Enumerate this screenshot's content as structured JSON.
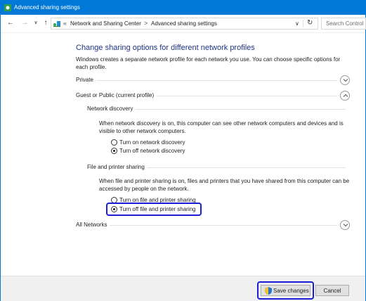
{
  "window": {
    "title": "Advanced sharing settings"
  },
  "address_bar": {
    "overflow_glyph": "«",
    "breadcrumbs": [
      "Network and Sharing Center",
      "Advanced sharing settings"
    ],
    "separator": ">",
    "search_placeholder": "Search Control"
  },
  "content": {
    "heading": "Change sharing options for different network profiles",
    "intro": "Windows creates a separate network profile for each network you use. You can choose specific options for each profile."
  },
  "profiles": {
    "private": {
      "label": "Private",
      "expanded": false
    },
    "guest_public": {
      "label": "Guest or Public (current profile)",
      "expanded": true
    },
    "all_networks": {
      "label": "All Networks",
      "expanded": false
    }
  },
  "network_discovery": {
    "title": "Network discovery",
    "description": "When network discovery is on, this computer can see other network computers and devices and is visible to other network computers.",
    "options": [
      {
        "label": "Turn on network discovery",
        "checked": false
      },
      {
        "label": "Turn off network discovery",
        "checked": true
      }
    ]
  },
  "file_printer_sharing": {
    "title": "File and printer sharing",
    "description": "When file and printer sharing is on, files and printers that you have shared from this computer can be accessed by people on the network.",
    "options": [
      {
        "label": "Turn on file and printer sharing",
        "checked": false
      },
      {
        "label": "Turn off file and printer sharing",
        "checked": true
      }
    ]
  },
  "footer": {
    "save_label": "Save changes",
    "cancel_label": "Cancel"
  },
  "colors": {
    "accent": "#0078d7",
    "heading": "#1e3287",
    "highlight": "#1c1cd4"
  }
}
